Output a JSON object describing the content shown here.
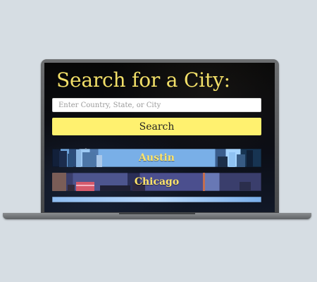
{
  "page": {
    "title": "Search for a City:"
  },
  "search": {
    "placeholder": "Enter Country, State, or City",
    "value": "",
    "button_label": "Search"
  },
  "cities": [
    {
      "label": "Austin"
    },
    {
      "label": "Chicago"
    }
  ],
  "colors": {
    "title": "#f2df68",
    "button": "#fff16f",
    "city_label": "#ffe46a",
    "background": "#d6dde3",
    "screen": "#070707"
  }
}
